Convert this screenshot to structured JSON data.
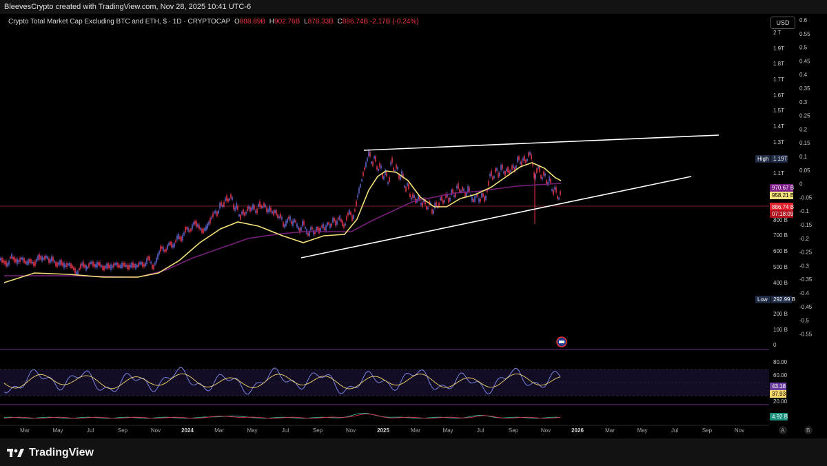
{
  "attribution": "BleevesCrypto created with TradingView.com, Nov 28, 2025 10:41 UTC-6",
  "legend": {
    "title": "Crypto Total Market Cap Excluding BTC and ETH, $ · 1D · CRYPTOCAP",
    "o_label": "O",
    "o_value": "888.89B",
    "h_label": "H",
    "h_value": "902.76B",
    "l_label": "L",
    "l_value": "878.33B",
    "c_label": "C",
    "c_value": "886.74B",
    "change": "-2.17B (-0.24%)"
  },
  "currency_button": "USD",
  "logo_text": "TradingView",
  "colors": {
    "up": "#5b63c8",
    "down": "#e0334a",
    "ma_fast": "#f5e27a",
    "ma_slow": "#7a1f7d",
    "trendline": "#ffffff",
    "rsi": "#7b83e0",
    "rsi_signal": "#f5d76e",
    "pane_border": "#6a2f86"
  },
  "chart_data": {
    "type": "line",
    "series": [
      {
        "values": [
          [
            0,
            375
          ],
          [
            6,
            380
          ],
          [
            12,
            385
          ],
          [
            16,
            370
          ],
          [
            20,
            376
          ],
          [
            26,
            380
          ],
          [
            32,
            374
          ],
          [
            38,
            382
          ],
          [
            44,
            378
          ],
          [
            50,
            384
          ],
          [
            56,
            372
          ],
          [
            62,
            376
          ],
          [
            68,
            372
          ],
          [
            72,
            380
          ],
          [
            76,
            374
          ],
          [
            82,
            385
          ],
          [
            88,
            380
          ],
          [
            94,
            386
          ],
          [
            100,
            383
          ],
          [
            106,
            388
          ],
          [
            112,
            398
          ],
          [
            116,
            388
          ],
          [
            120,
            382
          ],
          [
            126,
            390
          ],
          [
            132,
            380
          ],
          [
            138,
            386
          ],
          [
            144,
            382
          ],
          [
            150,
            390
          ],
          [
            156,
            385
          ],
          [
            162,
            388
          ],
          [
            168,
            382
          ],
          [
            174,
            387
          ],
          [
            180,
            383
          ],
          [
            186,
            388
          ],
          [
            192,
            384
          ],
          [
            198,
            387
          ],
          [
            204,
            381
          ],
          [
            210,
            386
          ],
          [
            216,
            372
          ],
          [
            222,
            390
          ],
          [
            228,
            375
          ],
          [
            234,
            358
          ],
          [
            240,
            365
          ],
          [
            246,
            352
          ],
          [
            252,
            358
          ],
          [
            258,
            342
          ],
          [
            264,
            348
          ],
          [
            270,
            330
          ],
          [
            276,
            336
          ],
          [
            282,
            322
          ],
          [
            288,
            328
          ],
          [
            294,
            336
          ],
          [
            300,
            330
          ],
          [
            306,
            318
          ],
          [
            312,
            306
          ],
          [
            316,
            312
          ],
          [
            320,
            294
          ],
          [
            324,
            300
          ],
          [
            328,
            286
          ],
          [
            332,
            292
          ],
          [
            336,
            282
          ],
          [
            340,
            306
          ],
          [
            344,
            296
          ],
          [
            348,
            318
          ],
          [
            352,
            306
          ],
          [
            356,
            312
          ],
          [
            360,
            300
          ],
          [
            364,
            305
          ],
          [
            368,
            298
          ],
          [
            372,
            310
          ],
          [
            376,
            294
          ],
          [
            380,
            302
          ],
          [
            384,
            296
          ],
          [
            388,
            307
          ],
          [
            392,
            302
          ],
          [
            396,
            310
          ],
          [
            400,
            306
          ],
          [
            404,
            316
          ],
          [
            408,
            312
          ],
          [
            412,
            330
          ],
          [
            416,
            322
          ],
          [
            420,
            314
          ],
          [
            424,
            326
          ],
          [
            428,
            318
          ],
          [
            432,
            330
          ],
          [
            436,
            336
          ],
          [
            440,
            320
          ],
          [
            444,
            334
          ],
          [
            448,
            342
          ],
          [
            452,
            328
          ],
          [
            456,
            340
          ],
          [
            460,
            330
          ],
          [
            464,
            336
          ],
          [
            468,
            326
          ],
          [
            472,
            334
          ],
          [
            476,
            322
          ],
          [
            480,
            330
          ],
          [
            484,
            316
          ],
          [
            488,
            326
          ],
          [
            492,
            314
          ],
          [
            496,
            322
          ],
          [
            500,
            330
          ],
          [
            504,
            312
          ],
          [
            508,
            306
          ],
          [
            512,
            320
          ],
          [
            516,
            300
          ],
          [
            520,
            280
          ],
          [
            524,
            266
          ],
          [
            528,
            248
          ],
          [
            532,
            236
          ],
          [
            536,
            218
          ],
          [
            540,
            242
          ],
          [
            544,
            224
          ],
          [
            548,
            250
          ],
          [
            552,
            236
          ],
          [
            556,
            262
          ],
          [
            560,
            246
          ],
          [
            564,
            272
          ],
          [
            568,
            226
          ],
          [
            572,
            252
          ],
          [
            576,
            238
          ],
          [
            580,
            262
          ],
          [
            584,
            248
          ],
          [
            588,
            278
          ],
          [
            592,
            264
          ],
          [
            596,
            290
          ],
          [
            600,
            282
          ],
          [
            604,
            294
          ],
          [
            608,
            284
          ],
          [
            612,
            300
          ],
          [
            616,
            288
          ],
          [
            620,
            306
          ],
          [
            624,
            290
          ],
          [
            628,
            312
          ],
          [
            632,
            294
          ],
          [
            636,
            302
          ],
          [
            640,
            284
          ],
          [
            644,
            296
          ],
          [
            648,
            280
          ],
          [
            652,
            294
          ],
          [
            656,
            274
          ],
          [
            660,
            288
          ],
          [
            664,
            266
          ],
          [
            668,
            280
          ],
          [
            672,
            272
          ],
          [
            676,
            286
          ],
          [
            680,
            270
          ],
          [
            684,
            288
          ],
          [
            688,
            292
          ],
          [
            692,
            280
          ],
          [
            696,
            294
          ],
          [
            700,
            280
          ],
          [
            704,
            292
          ],
          [
            708,
            272
          ],
          [
            712,
            248
          ],
          [
            716,
            262
          ],
          [
            720,
            242
          ],
          [
            724,
            258
          ],
          [
            728,
            238
          ],
          [
            732,
            254
          ],
          [
            736,
            244
          ],
          [
            740,
            252
          ],
          [
            744,
            240
          ],
          [
            748,
            248
          ],
          [
            752,
            226
          ],
          [
            756,
            240
          ],
          [
            760,
            228
          ],
          [
            764,
            236
          ],
          [
            768,
            220
          ],
          [
            772,
            230
          ],
          [
            776,
            262
          ],
          [
            778,
            250
          ],
          [
            782,
            240
          ],
          [
            786,
            262
          ],
          [
            790,
            248
          ],
          [
            794,
            270
          ],
          [
            798,
            256
          ],
          [
            802,
            282
          ],
          [
            806,
            270
          ],
          [
            810,
            292
          ],
          [
            814,
            276
          ]
        ]
      },
      {
        "values": [
          [
            6,
            410
          ],
          [
            50,
            396
          ],
          [
            100,
            398
          ],
          [
            150,
            402
          ],
          [
            200,
            402
          ],
          [
            230,
            396
          ],
          [
            260,
            378
          ],
          [
            290,
            352
          ],
          [
            320,
            332
          ],
          [
            345,
            322
          ],
          [
            375,
            328
          ],
          [
            410,
            342
          ],
          [
            440,
            352
          ],
          [
            470,
            342
          ],
          [
            500,
            340
          ],
          [
            518,
            318
          ],
          [
            535,
            276
          ],
          [
            548,
            256
          ],
          [
            560,
            248
          ],
          [
            575,
            250
          ],
          [
            592,
            262
          ],
          [
            610,
            286
          ],
          [
            630,
            300
          ],
          [
            648,
            300
          ],
          [
            668,
            288
          ],
          [
            690,
            282
          ],
          [
            712,
            272
          ],
          [
            735,
            256
          ],
          [
            755,
            242
          ],
          [
            772,
            236
          ],
          [
            790,
            244
          ],
          [
            806,
            258
          ],
          [
            814,
            262
          ]
        ]
      },
      {
        "values": [
          [
            6,
            400
          ],
          [
            100,
            400
          ],
          [
            200,
            402
          ],
          [
            240,
            392
          ],
          [
            280,
            374
          ],
          [
            320,
            360
          ],
          [
            360,
            346
          ],
          [
            400,
            340
          ],
          [
            440,
            336
          ],
          [
            480,
            336
          ],
          [
            510,
            336
          ],
          [
            540,
            320
          ],
          [
            570,
            306
          ],
          [
            600,
            292
          ],
          [
            630,
            286
          ],
          [
            660,
            280
          ],
          [
            690,
            278
          ],
          [
            720,
            274
          ],
          [
            750,
            270
          ],
          [
            780,
            268
          ],
          [
            814,
            266
          ]
        ]
      },
      {
        "values": [
          [
            437,
            374
          ],
          [
            1003,
            256
          ]
        ]
      },
      {
        "values": [
          [
            528,
            218
          ],
          [
            1043,
            196
          ]
        ]
      }
    ],
    "y_ticks_price": [
      "2 T",
      "1.9T",
      "1.8T",
      "1.7T",
      "1.6T",
      "1.5T",
      "1.4T",
      "1.3T",
      "1.1T",
      "800 B",
      "700 B",
      "600 B",
      "500 B",
      "400 B",
      "200 B",
      "100 B",
      "0"
    ],
    "y_ticks_pct": [
      "0.6",
      "0.55",
      "0.5",
      "0.45",
      "0.4",
      "0.35",
      "0.3",
      "0.25",
      "0.2",
      "0.15",
      "0.1",
      "0.05",
      "0",
      "-0.05",
      "-0.1",
      "-0.15",
      "-0.2",
      "-0.25",
      "-0.3",
      "-0.35",
      "-0.4",
      "-0.45",
      "-0.5",
      "-0.55"
    ],
    "x_ticks": [
      "Mar",
      "May",
      "Jul",
      "Sep",
      "Nov",
      "2024",
      "Mar",
      "May",
      "Jul",
      "Sep",
      "Nov",
      "2025",
      "Mar",
      "May",
      "Jul",
      "Sep",
      "Nov",
      "2026",
      "Mar",
      "May",
      "Jul",
      "Sep",
      "Nov"
    ],
    "badges": {
      "high_label": "High",
      "high_value": "1.19T",
      "low_label": "Low",
      "low_value": "292.99 B",
      "ma_slow_value": "970.67 B",
      "ma_fast_value": "958.21 B",
      "price_value": "886.74 B",
      "countdown": "07:18:09"
    },
    "rsi": {
      "ticks": [
        "80.00",
        "60.00",
        "20.00"
      ],
      "value_main": "43.18",
      "value_signal": "37.93"
    },
    "volume_badge": "4.92 B",
    "grid": false
  }
}
